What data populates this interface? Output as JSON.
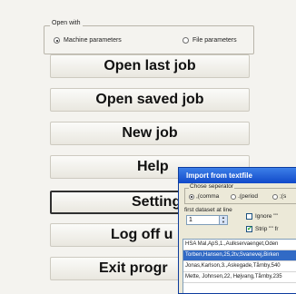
{
  "open_with": {
    "title": "Open with",
    "options": [
      {
        "label": "Machine parameters",
        "selected": true
      },
      {
        "label": "File parameters",
        "selected": false
      }
    ]
  },
  "buttons": {
    "open_last_job": "Open last job",
    "open_saved_job": "Open saved job",
    "new_job": "New job",
    "help": "Help",
    "settings": "Setting",
    "log_off": "Log off u",
    "exit_program": "Exit progr"
  },
  "import_dialog": {
    "title": "Import from textfile",
    "separator_group_title": "Chose seperator",
    "separators": [
      {
        "label": ",(comma",
        "selected": true
      },
      {
        "label": ".(period",
        "selected": false
      },
      {
        "label": ";(s",
        "selected": false
      }
    ],
    "first_dataset_label": "first dataset at line",
    "first_dataset_value": "1",
    "ignore_label": "Ignore \"\"",
    "ignore_checked": false,
    "strip_label": "Strip \"\" fr",
    "strip_checked": true,
    "rows": [
      {
        "text": "HSA Mal,ApS,1.,Aulkservaenget,Oden",
        "selected": false
      },
      {
        "text": "Torben,Hansen,25,2tv,Svanevej,Birken",
        "selected": true
      },
      {
        "text": "Jonas,Karlson,3.,Askegade,Tårnby,540",
        "selected": false
      },
      {
        "text": "Mette, Johnsen,22, Højvang,Tårnby,235",
        "selected": false
      }
    ]
  }
}
